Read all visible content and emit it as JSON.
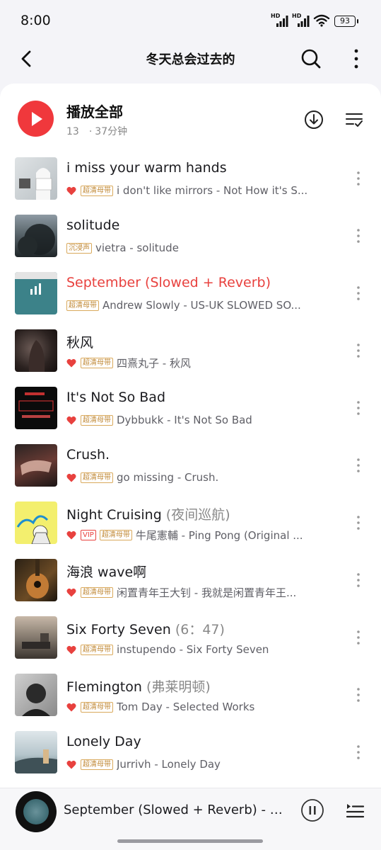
{
  "status": {
    "time": "8:00",
    "hd1": "HD",
    "hd2": "HD",
    "battery": "93"
  },
  "header": {
    "title": "冬天总会过去的",
    "back_icon": "chevron-left-icon",
    "search_icon": "search-icon",
    "more_icon": "more-vertical-icon"
  },
  "playall": {
    "label": "播放全部",
    "count": "13",
    "separator": "·",
    "duration": "37分钟"
  },
  "colors": {
    "accent": "#f0383c",
    "playing": "#e8413e",
    "tag": "#c18a38"
  },
  "songs": [
    {
      "title": "i miss your warm hands",
      "alt": "",
      "heart": true,
      "vip": "",
      "quality": "超清母带",
      "sub": "i don't like mirrors - Not How it's S..."
    },
    {
      "title": "solitude",
      "alt": "",
      "heart": false,
      "vip": "",
      "quality": "沉浸声",
      "sub": "vietra - solitude"
    },
    {
      "title": "September (Slowed + Reverb)",
      "alt": "",
      "heart": false,
      "vip": "",
      "quality": "超清母带",
      "sub": "Andrew Slowly - US-UK SLOWED SO..."
    },
    {
      "title": "秋风",
      "alt": "",
      "heart": true,
      "vip": "",
      "quality": "超清母带",
      "sub": "四熹丸子 - 秋风"
    },
    {
      "title": "It's Not So Bad",
      "alt": "",
      "heart": true,
      "vip": "",
      "quality": "超清母带",
      "sub": "Dybbukk - It's Not So Bad"
    },
    {
      "title": "Crush.",
      "alt": "",
      "heart": true,
      "vip": "",
      "quality": "超清母带",
      "sub": "go missing - Crush."
    },
    {
      "title": "Night Cruising",
      "alt": " (夜间巡航)",
      "heart": true,
      "vip": "VIP",
      "quality": "超清母带",
      "sub": "牛尾憲輔 - Ping Pong (Original ..."
    },
    {
      "title": "海浪 wave啊",
      "alt": "",
      "heart": true,
      "vip": "",
      "quality": "超清母带",
      "sub": "闲置青年王大钊 - 我就是闲置青年王..."
    },
    {
      "title": "Six Forty Seven",
      "alt": " (6：47)",
      "heart": true,
      "vip": "",
      "quality": "超清母带",
      "sub": "instupendo - Six Forty Seven"
    },
    {
      "title": "Flemington",
      "alt": " (弗莱明顿)",
      "heart": true,
      "vip": "",
      "quality": "超清母带",
      "sub": "Tom Day - Selected Works"
    },
    {
      "title": "Lonely Day",
      "alt": "",
      "heart": true,
      "vip": "",
      "quality": "超清母带",
      "sub": "Jurrivh - Lonely Day"
    }
  ],
  "player": {
    "title": "September (Slowed + Reverb) - A...",
    "pause_icon": "pause-icon",
    "queue_icon": "playlist-icon"
  }
}
